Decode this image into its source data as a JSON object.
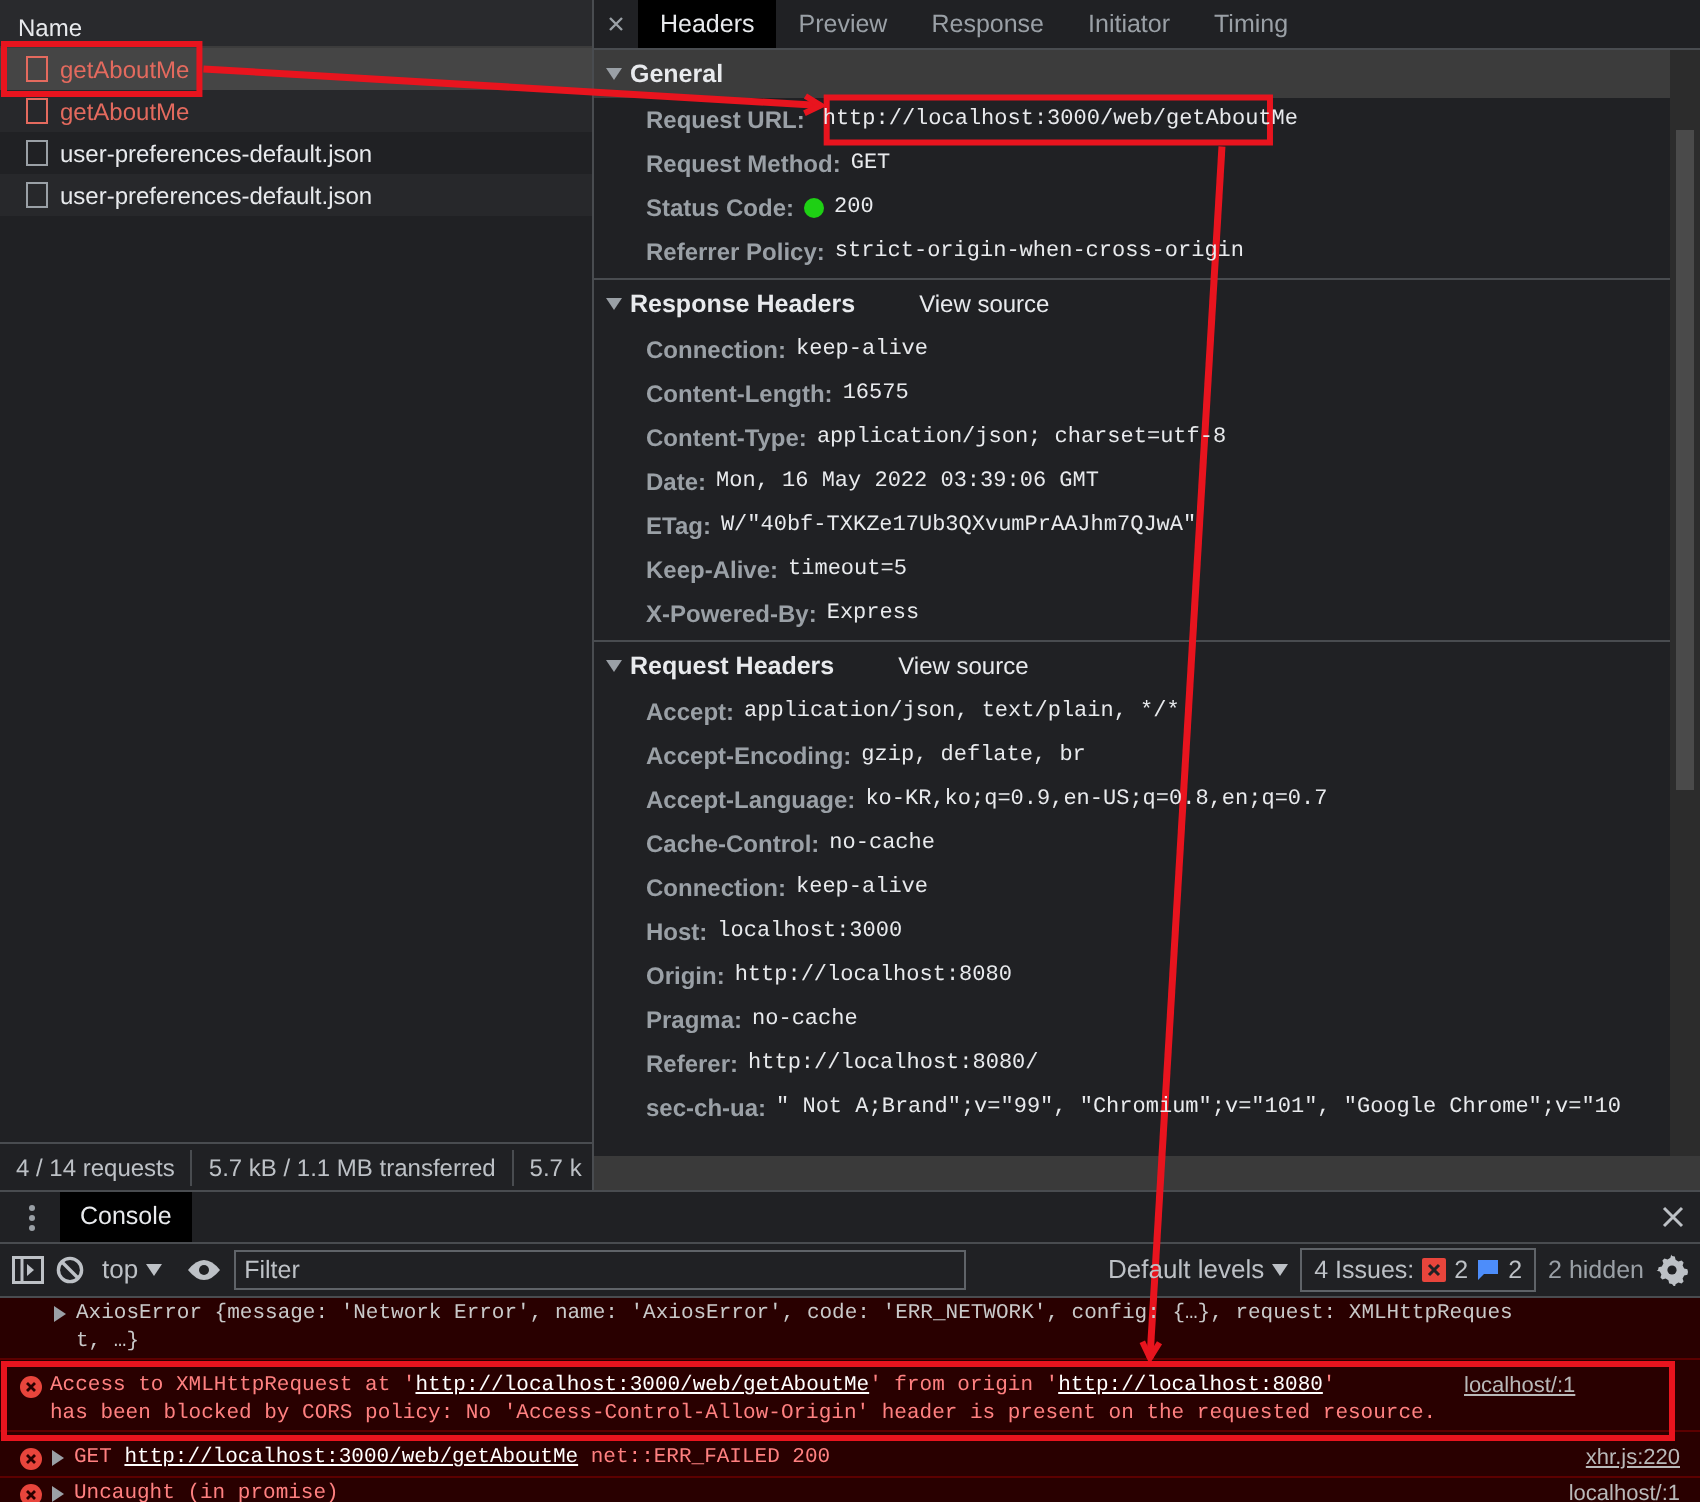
{
  "requests_panel": {
    "column_header": "Name",
    "requests": [
      {
        "name": "getAboutMe",
        "failed": true,
        "selected": true,
        "highlighted": true
      },
      {
        "name": "getAboutMe",
        "failed": true,
        "selected": false,
        "highlighted": false
      },
      {
        "name": "user-preferences-default.json",
        "failed": false,
        "selected": false,
        "highlighted": false
      },
      {
        "name": "user-preferences-default.json",
        "failed": false,
        "selected": false,
        "highlighted": false
      }
    ],
    "status_bar": [
      "4 / 14 requests",
      "5.7 kB / 1.1 MB transferred",
      "5.7 k"
    ]
  },
  "details_tabs": [
    {
      "label": "Headers",
      "selected": true
    },
    {
      "label": "Preview",
      "selected": false
    },
    {
      "label": "Response",
      "selected": false
    },
    {
      "label": "Initiator",
      "selected": false
    },
    {
      "label": "Timing",
      "selected": false
    }
  ],
  "sections": [
    {
      "title": "General",
      "expanded": true,
      "headers": [
        {
          "name": "Request URL:",
          "value": "http://localhost:3000/web/getAboutMe",
          "kind": "text",
          "highlighted": true
        },
        {
          "name": "Request Method:",
          "value": "GET",
          "kind": "text",
          "highlighted": false
        },
        {
          "name": "Status Code:",
          "value": "200",
          "kind": "status",
          "highlighted": false
        },
        {
          "name": "Referrer Policy:",
          "value": "strict-origin-when-cross-origin",
          "kind": "text",
          "highlighted": false
        }
      ]
    },
    {
      "title": "Response Headers",
      "view_source": "View source",
      "expanded": true,
      "headers": [
        {
          "name": "Connection:",
          "value": "keep-alive",
          "kind": "text",
          "highlighted": false
        },
        {
          "name": "Content-Length:",
          "value": "16575",
          "kind": "text",
          "highlighted": false
        },
        {
          "name": "Content-Type:",
          "value": "application/json; charset=utf-8",
          "kind": "text",
          "highlighted": false
        },
        {
          "name": "Date:",
          "value": "Mon, 16 May 2022 03:39:06 GMT",
          "kind": "text",
          "highlighted": false
        },
        {
          "name": "ETag:",
          "value": "W/\"40bf-TXKZe17Ub3QXvumPrAAJhm7QJwA\"",
          "kind": "text",
          "highlighted": false
        },
        {
          "name": "Keep-Alive:",
          "value": "timeout=5",
          "kind": "text",
          "highlighted": false
        },
        {
          "name": "X-Powered-By:",
          "value": "Express",
          "kind": "text",
          "highlighted": false
        }
      ]
    },
    {
      "title": "Request Headers",
      "view_source": "View source",
      "expanded": true,
      "headers": [
        {
          "name": "Accept:",
          "value": "application/json, text/plain, */*",
          "kind": "text",
          "highlighted": false
        },
        {
          "name": "Accept-Encoding:",
          "value": "gzip, deflate, br",
          "kind": "text",
          "highlighted": false
        },
        {
          "name": "Accept-Language:",
          "value": "ko-KR,ko;q=0.9,en-US;q=0.8,en;q=0.7",
          "kind": "text",
          "highlighted": false
        },
        {
          "name": "Cache-Control:",
          "value": "no-cache",
          "kind": "text",
          "highlighted": false
        },
        {
          "name": "Connection:",
          "value": "keep-alive",
          "kind": "text",
          "highlighted": false
        },
        {
          "name": "Host:",
          "value": "localhost:3000",
          "kind": "text",
          "highlighted": false
        },
        {
          "name": "Origin:",
          "value": "http://localhost:8080",
          "kind": "text",
          "highlighted": false
        },
        {
          "name": "Pragma:",
          "value": "no-cache",
          "kind": "text",
          "highlighted": false
        },
        {
          "name": "Referer:",
          "value": "http://localhost:8080/",
          "kind": "text",
          "highlighted": false
        },
        {
          "name": "sec-ch-ua:",
          "value": "\" Not A;Brand\";v=\"99\", \"Chromium\";v=\"101\", \"Google Chrome\";v=\"10",
          "kind": "text",
          "highlighted": false
        }
      ]
    }
  ],
  "console": {
    "tab": "Console",
    "context": "top",
    "filter_placeholder": "Filter",
    "levels": "Default levels",
    "issues_label": "4 Issues:",
    "error_issues": "2",
    "info_issues": "2",
    "hidden": "2 hidden",
    "messages": [
      {
        "kind": "object",
        "highlighted": false,
        "parts": [
          {
            "text": "AxiosError {message: 'Network Error', name: 'AxiosError', code: 'ERR_NETWORK', config: {…}, request: XMLHttpReques t, …}"
          }
        ]
      },
      {
        "kind": "error",
        "highlighted": true,
        "parts": [
          {
            "text": "Access to XMLHttpRequest at '"
          },
          {
            "link": "http://localhost:3000/web/getAboutMe"
          },
          {
            "text": "' from origin '"
          },
          {
            "link": "http://localhost:8080"
          },
          {
            "text": "' has been blocked by CORS policy: No 'Access-Control-Allow-Origin' header is present on the requested resource."
          }
        ],
        "source": "localhost/:1"
      },
      {
        "kind": "error_expandable",
        "highlighted": false,
        "parts": [
          {
            "text": "GET "
          },
          {
            "link": "http://localhost:3000/web/getAboutMe"
          },
          {
            "text": " net::ERR_FAILED 200"
          }
        ],
        "source": "xhr.js:220"
      },
      {
        "kind": "error_expandable",
        "highlighted": false,
        "parts": [
          {
            "text": "Uncaught (in promise)"
          }
        ],
        "source": "localhost/:1"
      }
    ]
  }
}
